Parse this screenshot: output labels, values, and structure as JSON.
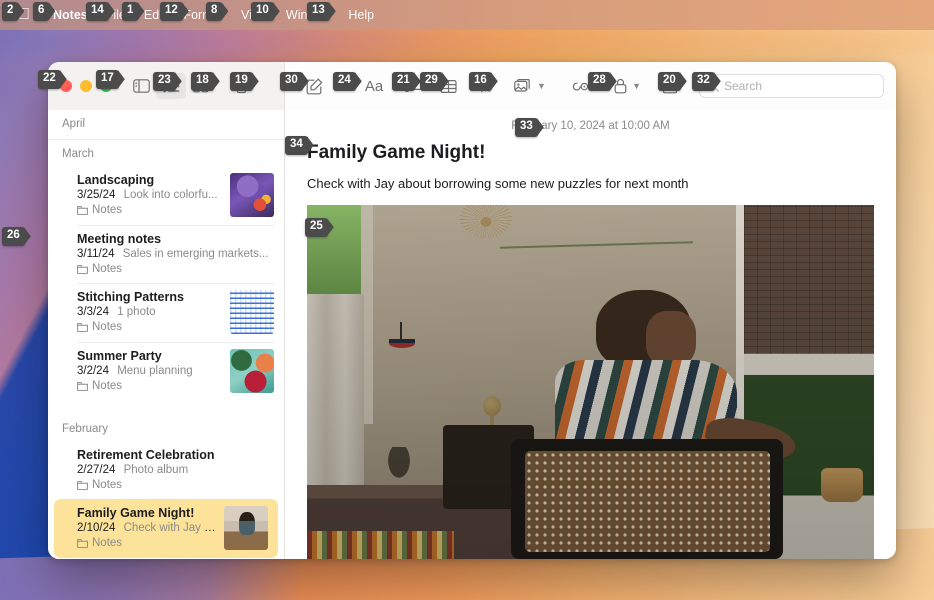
{
  "menubar": {
    "apple_badge": "2",
    "items": [
      {
        "label": "Notes",
        "badge": "6",
        "bold": true
      },
      {
        "label": "File",
        "badge": "14",
        "bold": false
      },
      {
        "label": "Edit",
        "badge": "1",
        "bold": false
      },
      {
        "label": "Format",
        "badge": "12",
        "bold": false
      },
      {
        "label": "View",
        "badge": "8",
        "bold": false
      },
      {
        "label": "Window",
        "badge": "10",
        "bold": false
      },
      {
        "label": "Help",
        "badge": "13",
        "bold": false
      }
    ]
  },
  "desktop": {
    "badge": "26"
  },
  "window": {
    "traffic_lights": {
      "close_badge": "22",
      "close_label": "close",
      "minimize_label": "minimize",
      "zoom_badge": "17",
      "zoom_label": "zoom"
    },
    "toolbar": {
      "sidebar_toggle": {
        "label": "Toggle Sidebar",
        "badge": ""
      },
      "list_view": {
        "label": "List View",
        "badge": "23"
      },
      "gallery_view": {
        "label": "Gallery View",
        "badge": "18"
      },
      "delete": {
        "label": "Delete Note",
        "badge": "19"
      },
      "compose": {
        "label": "New Note",
        "badge": "30"
      },
      "format": {
        "label": "Format",
        "badge": "24",
        "glyph": "Aa"
      },
      "checklist": {
        "label": "Checklist",
        "badge": "21"
      },
      "table": {
        "label": "Table",
        "badge": "29"
      },
      "link": {
        "label": "Link",
        "badge": "16"
      },
      "media": {
        "label": "Media",
        "badge": ""
      },
      "collaborate": {
        "label": "Collaborate",
        "badge": "28"
      },
      "lock": {
        "label": "Lock Note",
        "badge": ""
      },
      "share": {
        "label": "Share",
        "badge": "20"
      }
    },
    "search": {
      "badge": "32",
      "placeholder": "Search",
      "value": ""
    }
  },
  "notes_list": {
    "sections": [
      {
        "month": "April",
        "notes": []
      },
      {
        "month": "March",
        "notes": [
          {
            "title": "Landscaping",
            "date": "3/25/24",
            "preview": "Look into colorfu...",
            "folder": "Notes",
            "thumb": "flower",
            "selected": false
          },
          {
            "title": "Meeting notes",
            "date": "3/11/24",
            "preview": "Sales in emerging markets...",
            "folder": "Notes",
            "thumb": "none",
            "selected": false
          },
          {
            "title": "Stitching Patterns",
            "date": "3/3/24",
            "preview": "1 photo",
            "folder": "Notes",
            "thumb": "stitch",
            "selected": false
          },
          {
            "title": "Summer Party",
            "date": "3/2/24",
            "preview": "Menu planning",
            "folder": "Notes",
            "thumb": "food",
            "selected": false
          }
        ]
      },
      {
        "month": "February",
        "notes": [
          {
            "title": "Retirement Celebration",
            "date": "2/27/24",
            "preview": "Photo album",
            "folder": "Notes",
            "thumb": "none",
            "selected": false
          },
          {
            "title": "Family Game Night!",
            "date": "2/10/24",
            "preview": "Check with Jay a...",
            "folder": "Notes",
            "thumb": "boy",
            "selected": true
          }
        ]
      }
    ]
  },
  "note": {
    "date_badge": "33",
    "date": "February 10, 2024 at 10:00 AM",
    "title_badge": "34",
    "title": "Family Game Night!",
    "body": "Check with Jay about borrowing some new puzzles for next month",
    "photo_badge": "25",
    "photo_alt": "Boy at a table with a puzzle in a sunlit room"
  },
  "colors": {
    "selected_note": "#fde39a",
    "accent_orange": "#f0a85e",
    "badge_bg": "#4b4b4b"
  }
}
